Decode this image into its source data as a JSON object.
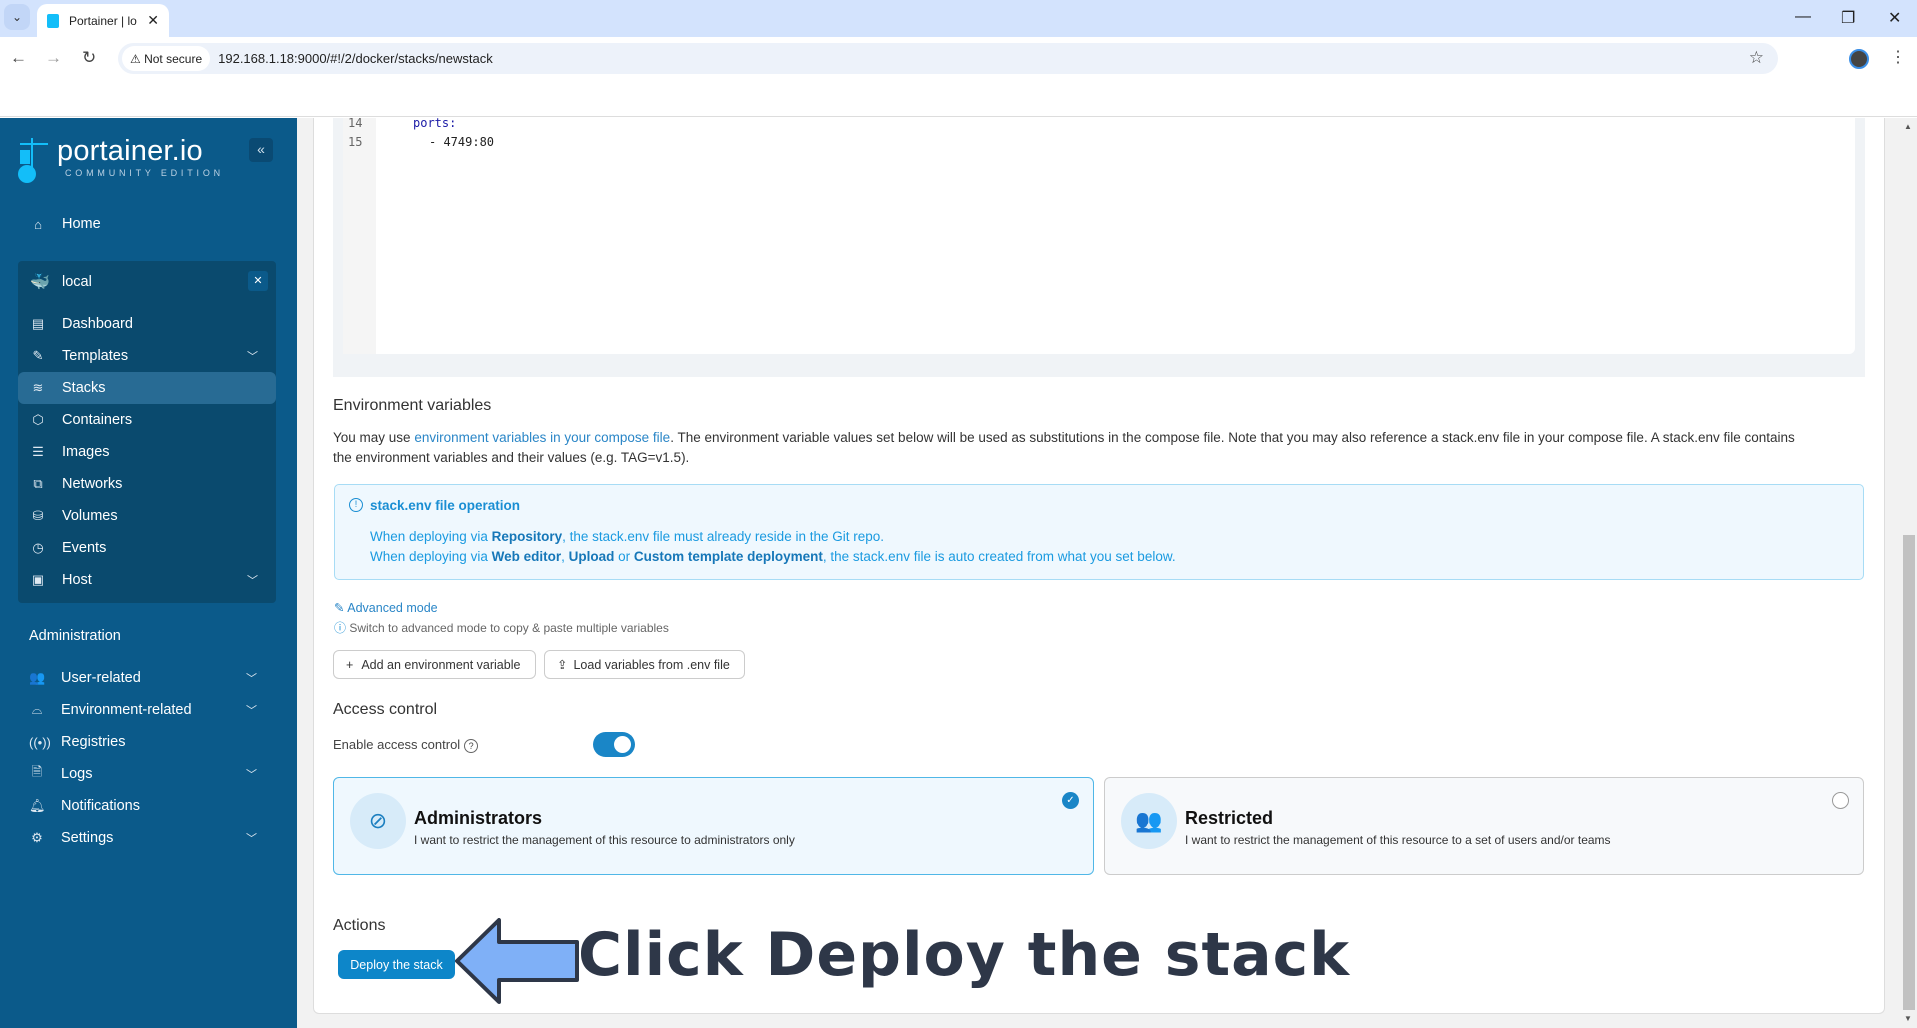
{
  "browser": {
    "tab_title": "Portainer | lo",
    "not_secure": "Not secure",
    "url": "192.168.1.18:9000/#!/2/docker/stacks/newstack"
  },
  "sidebar": {
    "logo_text": "portainer.io",
    "logo_sub": "COMMUNITY EDITION",
    "home": "Home",
    "environment": "local",
    "env_items": [
      {
        "label": "Dashboard",
        "icon": "dashboard-icon"
      },
      {
        "label": "Templates",
        "icon": "edit-icon",
        "expandable": true
      },
      {
        "label": "Stacks",
        "icon": "layers-icon",
        "active": true
      },
      {
        "label": "Containers",
        "icon": "box-icon"
      },
      {
        "label": "Images",
        "icon": "list-icon"
      },
      {
        "label": "Networks",
        "icon": "network-icon"
      },
      {
        "label": "Volumes",
        "icon": "database-icon"
      },
      {
        "label": "Events",
        "icon": "clock-icon"
      },
      {
        "label": "Host",
        "icon": "host-icon",
        "expandable": true
      }
    ],
    "admin_title": "Administration",
    "admin_items": [
      {
        "label": "User-related",
        "icon": "users-icon",
        "expandable": true
      },
      {
        "label": "Environment-related",
        "icon": "drive-icon",
        "expandable": true
      },
      {
        "label": "Registries",
        "icon": "radio-icon"
      },
      {
        "label": "Logs",
        "icon": "file-icon",
        "expandable": true
      },
      {
        "label": "Notifications",
        "icon": "bell-icon"
      },
      {
        "label": "Settings",
        "icon": "gear-icon",
        "expandable": true
      }
    ]
  },
  "editor": {
    "lines": [
      {
        "num": "14",
        "indent": "    ",
        "text": "ports:"
      },
      {
        "num": "15",
        "indent": "      ",
        "text": "- 4749:80"
      }
    ]
  },
  "env_vars": {
    "title": "Environment variables",
    "para_pre": "You may use ",
    "para_link": "environment variables in your compose file",
    "para_post": ". The environment variable values set below will be used as substitutions in the compose file. Note that you may also reference a stack.env file in your compose file. A stack.env file contains the environment variables and their values (e.g. TAG=v1.5).",
    "info_title": "stack.env file operation",
    "info_line1_pre": "When deploying via ",
    "info_line1_b": "Repository",
    "info_line1_post": ", the stack.env file must already reside in the Git repo.",
    "info_line2_pre": "When deploying via ",
    "info_line2_b1": "Web editor",
    "info_line2_sep": ", ",
    "info_line2_b2": "Upload",
    "info_line2_or": " or ",
    "info_line2_b3": "Custom template deployment",
    "info_line2_post": ", the stack.env file is auto created from what you set below.",
    "advanced_mode": "Advanced mode",
    "advanced_hint": "Switch to advanced mode to copy & paste multiple variables",
    "add_button": "Add an environment variable",
    "load_button": "Load variables from .env file"
  },
  "access_control": {
    "title": "Access control",
    "enable_label": "Enable access control",
    "enabled": true,
    "options": [
      {
        "title": "Administrators",
        "desc": "I want to restrict the management of this resource to administrators only",
        "selected": true
      },
      {
        "title": "Restricted",
        "desc": "I want to restrict the management of this resource to a set of users and/or teams",
        "selected": false
      }
    ]
  },
  "actions": {
    "title": "Actions",
    "deploy_button": "Deploy the stack"
  },
  "annotation": {
    "text": "Click Deploy the stack"
  }
}
